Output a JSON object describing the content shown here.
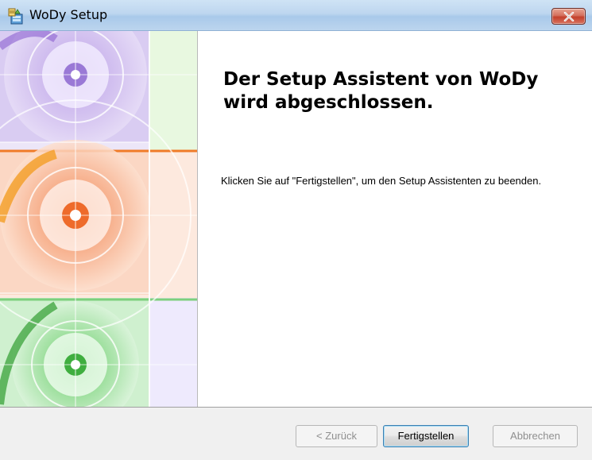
{
  "window": {
    "title": "WoDy Setup",
    "icon": "setup-installer-icon",
    "close_icon": "close-x-icon"
  },
  "main": {
    "heading": "Der Setup Assistent von WoDy wird abgeschlossen.",
    "body": "Klicken Sie auf \"Fertigstellen\", um den Setup Assistenten zu beenden."
  },
  "footer": {
    "back_label": "< Zurück",
    "finish_label": "Fertigstellen",
    "cancel_label": "Abbrechen"
  },
  "colors": {
    "title_bar": "#bdd6ef",
    "close_button": "#c3402b",
    "footer_bg": "#f0f0f0",
    "banner_purple": "#d9ccf2",
    "banner_orange": "#f59a6b",
    "banner_green": "#a6dea6"
  }
}
